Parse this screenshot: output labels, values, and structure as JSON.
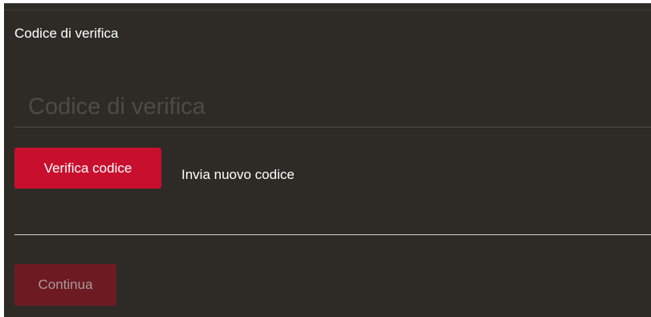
{
  "verification": {
    "label": "Codice di verifica",
    "input_placeholder": "Codice di verifica",
    "input_value": "",
    "verify_button_label": "Verifica codice",
    "resend_link_label": "Invia nuovo codice"
  },
  "footer": {
    "continue_button_label": "Continua",
    "continue_disabled": true
  },
  "colors": {
    "background": "#2e2b27",
    "accent": "#c8102e",
    "accent_disabled": "#6e1a22",
    "text": "#ffffff",
    "placeholder": "#4e4a46"
  }
}
